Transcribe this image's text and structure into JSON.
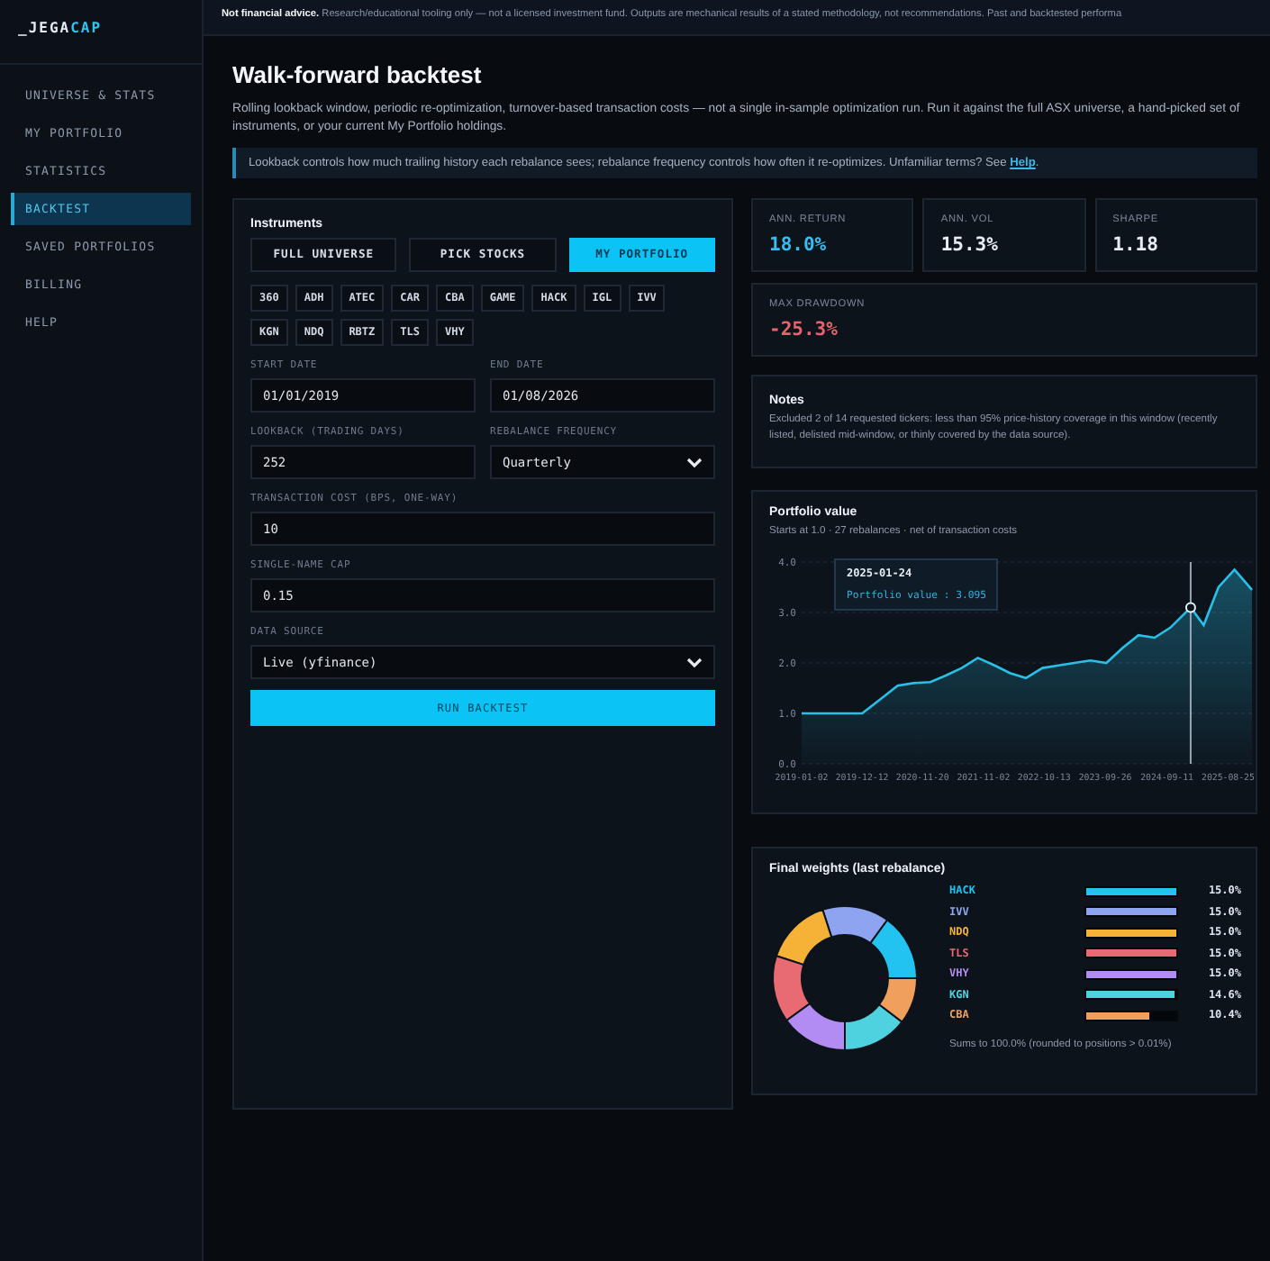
{
  "logo": {
    "prefix": "_JEGA",
    "accent": "CAP"
  },
  "sidebar": {
    "items": [
      {
        "label": "UNIVERSE & STATS",
        "selected": false
      },
      {
        "label": "MY PORTFOLIO",
        "selected": false
      },
      {
        "label": "STATISTICS",
        "selected": false
      },
      {
        "label": "BACKTEST",
        "selected": true
      },
      {
        "label": "SAVED PORTFOLIOS",
        "selected": false
      },
      {
        "label": "BILLING",
        "selected": false
      },
      {
        "label": "HELP",
        "selected": false
      }
    ]
  },
  "banner": "**Not financial advice.** Research/educational tooling only — not a licensed investment fund. Outputs are mechanical results of a stated methodology, not recommendations. Past and backtested performa",
  "title": "Walk-forward backtest",
  "description": "Rolling lookback window, periodic re-optimization, turnover-based transaction costs — not a single in-sample optimization run. Run it against the full ASX universe, a hand-picked set of instruments, or your current My Portfolio holdings.",
  "info": {
    "text": "Lookback controls how much trailing history each rebalance sees; rebalance frequency controls how often it re-optimizes. Unfamiliar terms? See ",
    "link": "Help",
    "suffix": "."
  },
  "form": {
    "instruments_label": "Instruments",
    "modes": [
      {
        "label": "FULL UNIVERSE",
        "selected": false
      },
      {
        "label": "PICK STOCKS",
        "selected": false
      },
      {
        "label": "MY PORTFOLIO",
        "selected": true
      }
    ],
    "tickers": [
      "360",
      "ADH",
      "ATEC",
      "CAR",
      "CBA",
      "GAME",
      "HACK",
      "IGL",
      "IVV",
      "KGN",
      "NDQ",
      "RBTZ",
      "TLS",
      "VHY"
    ],
    "fields": [
      {
        "kind": "input",
        "label": "START DATE",
        "value": "01/01/2019",
        "half": true
      },
      {
        "kind": "input",
        "label": "END DATE",
        "value": "01/08/2026",
        "half": true
      },
      {
        "kind": "input",
        "label": "LOOKBACK (TRADING DAYS)",
        "value": "252",
        "half": true
      },
      {
        "kind": "select",
        "label": "REBALANCE FREQUENCY",
        "value": "Quarterly",
        "half": true
      },
      {
        "kind": "input",
        "label": "TRANSACTION COST (BPS, ONE-WAY)",
        "value": "10",
        "half": false
      },
      {
        "kind": "input",
        "label": "SINGLE-NAME CAP",
        "value": "0.15",
        "half": false
      },
      {
        "kind": "select",
        "label": "DATA SOURCE",
        "value": "Live (yfinance)",
        "half": false
      }
    ],
    "run_button": "RUN BACKTEST"
  },
  "stats": [
    {
      "label": "ANN. RETURN",
      "value": "18.0%",
      "color": "#38bdf0"
    },
    {
      "label": "ANN. VOL",
      "value": "15.3%",
      "color": "#e8edf4"
    },
    {
      "label": "SHARPE",
      "value": "1.18",
      "color": "#e8edf4"
    },
    {
      "label": "MAX DRAWDOWN",
      "value": "-25.3%",
      "color": "#e8636c"
    }
  ],
  "notes": {
    "title": "Notes",
    "text": "Excluded 2 of 14 requested tickers: less than 95% price-history coverage in this window (recently listed, delisted mid-window, or thinly covered by the data source)."
  },
  "portfolio_value": {
    "title": "Portfolio value",
    "subtitle": "Starts at 1.0 · 27 rebalances · net of transaction costs",
    "tooltip": {
      "date": "2025-01-24",
      "text": "Portfolio value : 3.095"
    },
    "chart_data": {
      "type": "area",
      "grid": true,
      "ref_lines": [
        {
          "axis": "x",
          "value": "2025-01-24"
        }
      ],
      "xlim": [
        "2019-01-02",
        "2026-01-08"
      ],
      "x": [
        "2019-01-02",
        "2019-04-01",
        "2019-07-01",
        "2019-10-01",
        "2019-12-12",
        "2020-04-01",
        "2020-07-01",
        "2020-10-01",
        "2021-01-04",
        "2021-04-01",
        "2021-07-01",
        "2021-10-01",
        "2022-01-04",
        "2022-04-01",
        "2022-07-01",
        "2022-10-04",
        "2023-01-04",
        "2023-04-03",
        "2023-07-03",
        "2023-10-03",
        "2024-01-03",
        "2024-04-02",
        "2024-07-02",
        "2024-10-01",
        "2025-01-24",
        "2025-04-08",
        "2025-07-01",
        "2025-10-01",
        "2026-01-08"
      ],
      "series": [
        {
          "color": "#29c0e8",
          "values": [
            1.0,
            1.0,
            1.0,
            1.0,
            1.0,
            1.3,
            1.55,
            1.6,
            1.62,
            1.75,
            1.9,
            2.1,
            1.95,
            1.8,
            1.7,
            1.9,
            1.95,
            2.0,
            2.05,
            2.0,
            2.3,
            2.55,
            2.5,
            2.7,
            3.1,
            2.75,
            3.5,
            3.85,
            3.45
          ]
        }
      ],
      "ylim": [
        0,
        4
      ],
      "yticks": [
        {
          "value": 0,
          "label": "0.0"
        },
        {
          "value": 1,
          "label": "1.0"
        },
        {
          "value": 2,
          "label": "2.0"
        },
        {
          "value": 3,
          "label": "3.0"
        },
        {
          "value": 4,
          "label": "4.0"
        }
      ],
      "xticks": [
        "2019-01-02",
        "2019-12-12",
        "2020-11-20",
        "2021-11-02",
        "2022-10-13",
        "2023-09-26",
        "2024-09-11",
        "2025-08-25"
      ]
    }
  },
  "weights": {
    "title": "Final weights (last rebalance)",
    "footnote": "Sums to 100.0% (rounded to positions > 0.01%)",
    "items": [
      {
        "reading": "15.0%",
        "level": 1.0,
        "color": "#22c3f0"
      },
      {
        "reading": "15.0%",
        "level": 1.0,
        "color": "#8fa4f0"
      },
      {
        "reading": "15.0%",
        "level": 1.0,
        "color": "#f5b236"
      },
      {
        "reading": "15.0%",
        "level": 1.0,
        "color": "#e86a72"
      },
      {
        "reading": "15.0%",
        "level": 1.0,
        "color": "#b28cf2"
      },
      {
        "reading": "14.6%",
        "level": 0.97,
        "color": "#4fd2e0"
      },
      {
        "reading": "10.4%",
        "level": 0.69,
        "color": "#f0a05c"
      }
    ],
    "chart_data": {
      "type": "donut",
      "categories": [
        "HACK",
        "IVV",
        "NDQ",
        "TLS",
        "VHY",
        "KGN",
        "CBA"
      ],
      "values": [
        15.0,
        15.0,
        15.0,
        15.0,
        15.0,
        14.6,
        10.4
      ]
    }
  }
}
